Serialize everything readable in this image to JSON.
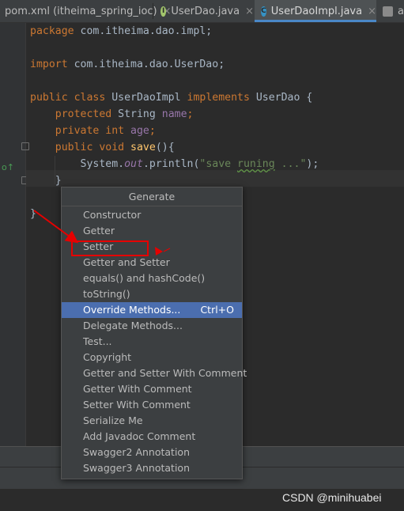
{
  "tabs": [
    {
      "label": "pom.xml (itheima_spring_ioc)",
      "icon": "m-maven-icon",
      "active": false
    },
    {
      "label": "UserDao.java",
      "icon": "interface-icon",
      "icon_letter": "I",
      "icon_color": "#a2c56c",
      "active": false
    },
    {
      "label": "UserDaoImpl.java",
      "icon": "class-icon",
      "icon_letter": "C",
      "icon_color": "#3592c4",
      "active": true
    },
    {
      "label": "ap",
      "icon": "file-icon",
      "active": false
    }
  ],
  "tab_close": "×",
  "code": {
    "l1": {
      "kw": "package",
      "rest": " com.itheima.dao.impl;"
    },
    "l2": {
      "kw": "import",
      "rest": " com.itheima.dao.UserDao;"
    },
    "l3": {
      "kw1": "public class",
      "name": " UserDaoImpl ",
      "kw2": "implements",
      "rest": " UserDao {"
    },
    "l4": {
      "indent": "    ",
      "kw": "protected",
      "type": " String ",
      "field": "name",
      "semi": ";"
    },
    "l5": {
      "indent": "    ",
      "kw": "private int",
      "field": " age",
      "semi": ";"
    },
    "l6": {
      "indent": "    ",
      "kw": "public void",
      "fn": " save",
      "rest": "(){"
    },
    "l7": {
      "indent": "        ",
      "pre": "System.",
      "field": "out",
      "mid": ".println(",
      "str_a": "\"save ",
      "str_typo": "runing",
      "str_b": " ...\"",
      "end": ");"
    },
    "l8": {
      "indent": "    ",
      "rest": "}"
    },
    "l9": {
      "rest": "}"
    }
  },
  "popup": {
    "title": "Generate",
    "items": [
      {
        "label": "Constructor"
      },
      {
        "label": "Getter"
      },
      {
        "label": "Setter"
      },
      {
        "label": "Getter and Setter"
      },
      {
        "label": "equals() and hashCode()"
      },
      {
        "label": "toString()"
      },
      {
        "label": "Override Methods...",
        "shortcut": "Ctrl+O",
        "selected": true
      },
      {
        "label": "Delegate Methods..."
      },
      {
        "label": "Test..."
      },
      {
        "label": "Copyright"
      },
      {
        "label": "Getter and Setter With Comment"
      },
      {
        "label": "Getter With Comment"
      },
      {
        "label": "Setter With Comment"
      },
      {
        "label": "Serialize Me"
      },
      {
        "label": "Add Javadoc Comment"
      },
      {
        "label": "Swagger2 Annotation"
      },
      {
        "label": "Swagger3 Annotation"
      }
    ]
  },
  "watermark": "CSDN @minihuabei",
  "colors": {
    "keyword": "#cc7832",
    "field": "#9876aa",
    "string": "#6a8759",
    "method": "#ffc66d",
    "selection": "#4b6eaf",
    "annotation": "#e60000"
  }
}
